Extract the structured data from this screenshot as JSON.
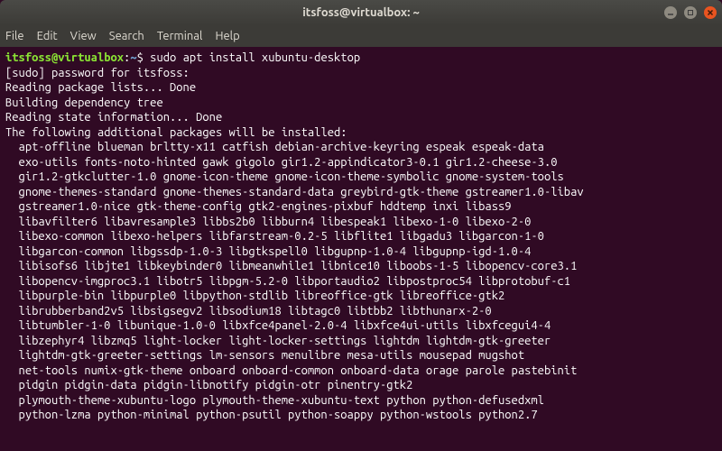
{
  "window": {
    "title": "itsfoss@virtualbox: ~"
  },
  "menubar": {
    "file": "File",
    "edit": "Edit",
    "view": "View",
    "search": "Search",
    "terminal": "Terminal",
    "help": "Help"
  },
  "prompt": {
    "userhost": "itsfoss@virtualbox",
    "sep": ":",
    "path": "~",
    "dollar": "$",
    "command": "sudo apt install xubuntu-desktop"
  },
  "lines": {
    "l1": "[sudo] password for itsfoss:",
    "l2": "Reading package lists... Done",
    "l3": "Building dependency tree",
    "l4": "Reading state information... Done",
    "l5": "The following additional packages will be installed:",
    "p1": "apt-offline blueman brltty-x11 catfish debian-archive-keyring espeak espeak-data",
    "p2": "exo-utils fonts-noto-hinted gawk gigolo gir1.2-appindicator3-0.1 gir1.2-cheese-3.0",
    "p3": "gir1.2-gtkclutter-1.0 gnome-icon-theme gnome-icon-theme-symbolic gnome-system-tools",
    "p4": "gnome-themes-standard gnome-themes-standard-data greybird-gtk-theme gstreamer1.0-libav",
    "p5": "gstreamer1.0-nice gtk-theme-config gtk2-engines-pixbuf hddtemp inxi libass9",
    "p6": "libavfilter6 libavresample3 libbs2b0 libburn4 libespeak1 libexo-1-0 libexo-2-0",
    "p7": "libexo-common libexo-helpers libfarstream-0.2-5 libflite1 libgadu3 libgarcon-1-0",
    "p8": "libgarcon-common libgssdp-1.0-3 libgtkspell0 libgupnp-1.0-4 libgupnp-igd-1.0-4",
    "p9": "libisofs6 libjte1 libkeybinder0 libmeanwhile1 libnice10 liboobs-1-5 libopencv-core3.1",
    "p10": "libopencv-imgproc3.1 libotr5 libpgm-5.2-0 libportaudio2 libpostproc54 libprotobuf-c1",
    "p11": "libpurple-bin libpurple0 libpython-stdlib libreoffice-gtk libreoffice-gtk2",
    "p12": "librubberband2v5 libsigsegv2 libsodium18 libtagc0 libtbb2 libthunarx-2-0",
    "p13": "libtumbler-1-0 libunique-1.0-0 libxfce4panel-2.0-4 libxfce4ui-utils libxfcegui4-4",
    "p14": "libzephyr4 libzmq5 light-locker light-locker-settings lightdm lightdm-gtk-greeter",
    "p15": "lightdm-gtk-greeter-settings lm-sensors menulibre mesa-utils mousepad mugshot",
    "p16": "net-tools numix-gtk-theme onboard onboard-common onboard-data orage parole pastebinit",
    "p17": "pidgin pidgin-data pidgin-libnotify pidgin-otr pinentry-gtk2",
    "p18": "plymouth-theme-xubuntu-logo plymouth-theme-xubuntu-text python python-defusedxml",
    "p19": "python-lzma python-minimal python-psutil python-soappy python-wstools python2.7"
  }
}
